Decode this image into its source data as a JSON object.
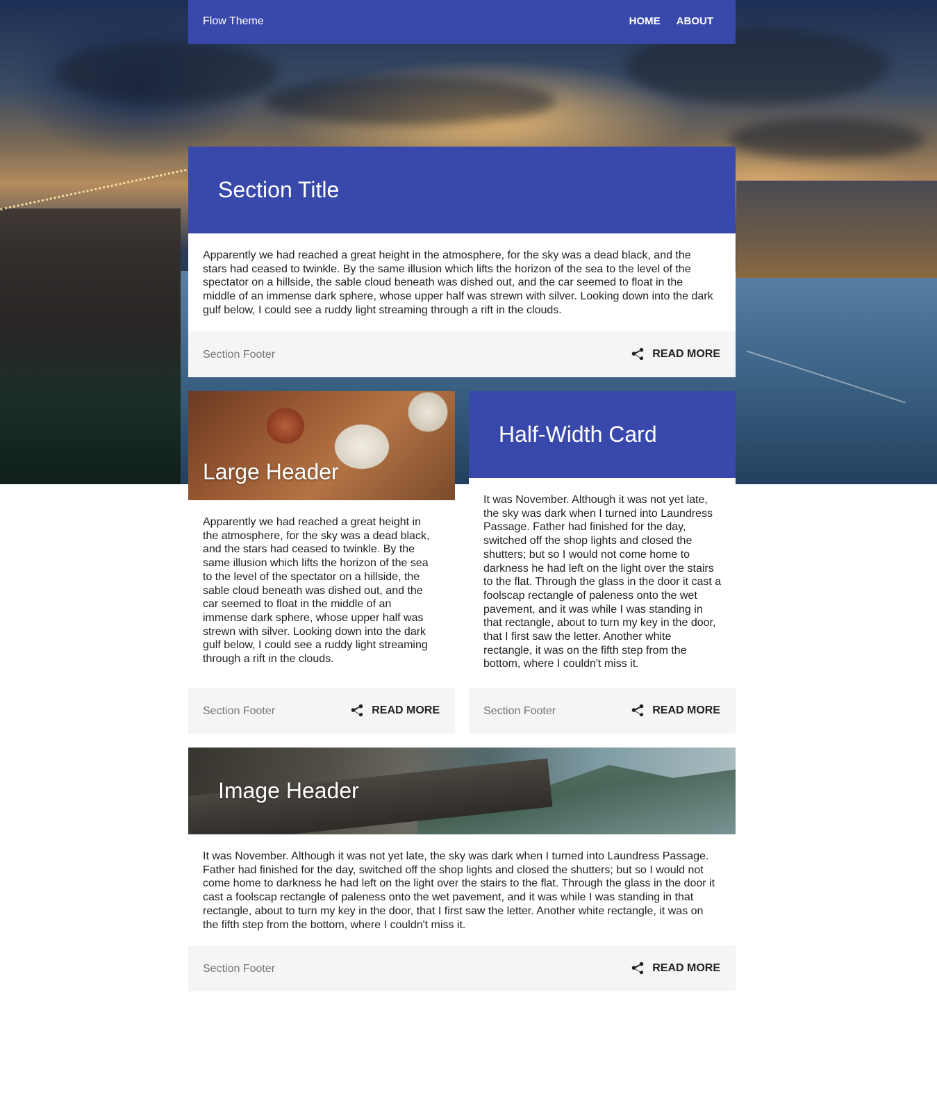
{
  "navbar": {
    "brand": "Flow Theme",
    "links": [
      "HOME",
      "ABOUT"
    ]
  },
  "cards": {
    "section": {
      "title": "Section Title",
      "body": "Apparently we had reached a great height in the atmosphere, for the sky was a dead black, and the stars had ceased to twinkle. By the same illusion which lifts the horizon of the sea to the level of the spectator on a hillside, the sable cloud beneath was dished out, and the car seemed to float in the middle of an immense dark sphere, whose upper half was strewn with silver. Looking down into the dark gulf below, I could see a ruddy light streaming through a rift in the clouds.",
      "footer": "Section Footer",
      "action": "READ MORE"
    },
    "large": {
      "title": "Large Header",
      "body": "Apparently we had reached a great height in the atmosphere, for the sky was a dead black, and the stars had ceased to twinkle. By the same illusion which lifts the horizon of the sea to the level of the spectator on a hillside, the sable cloud beneath was dished out, and the car seemed to float in the middle of an immense dark sphere, whose upper half was strewn with silver. Looking down into the dark gulf below, I could see a ruddy light streaming through a rift in the clouds.",
      "footer": "Section Footer",
      "action": "READ MORE"
    },
    "half": {
      "title": "Half-Width Card",
      "body": "It was November. Although it was not yet late, the sky was dark when I turned into Laundress Passage. Father had finished for the day, switched off the shop lights and closed the shutters; but so I would not come home to darkness he had left on the light over the stairs to the flat. Through the glass in the door it cast a foolscap rectangle of paleness onto the wet pavement, and it was while I was standing in that rectangle, about to turn my key in the door, that I first saw the letter. Another white rectangle, it was on the fifth step from the bottom, where I couldn't miss it.",
      "footer": "Section Footer",
      "action": "READ MORE"
    },
    "image": {
      "title": "Image Header",
      "body": "It was November. Although it was not yet late, the sky was dark when I turned into Laundress Passage. Father had finished for the day, switched off the shop lights and closed the shutters; but so I would not come home to darkness he had left on the light over the stairs to the flat. Through the glass in the door it cast a foolscap rectangle of paleness onto the wet pavement, and it was while I was standing in that rectangle, about to turn my key in the door, that I first saw the letter. Another white rectangle, it was on the fifth step from the bottom, where I couldn't miss it.",
      "footer": "Section Footer",
      "action": "READ MORE"
    }
  },
  "icons": {
    "share": "share-icon"
  },
  "colors": {
    "primary": "#3949ab",
    "footer_bg": "#f5f5f5"
  }
}
